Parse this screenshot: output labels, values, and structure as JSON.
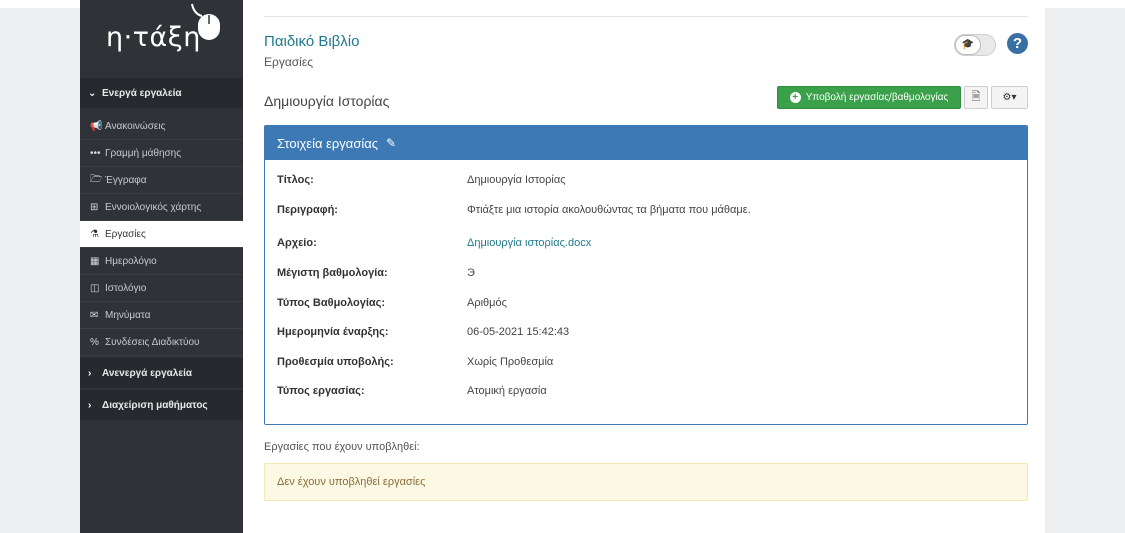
{
  "brand": {
    "logo_text": "η·τάξη"
  },
  "sidebar": {
    "sections": [
      {
        "label": "Ενεργά εργαλεία",
        "icon": "chevron-down-icon"
      },
      {
        "label": "Ανενεργά εργαλεία",
        "icon": "chevron-right-icon"
      },
      {
        "label": "Διαχείριση μαθήματος",
        "icon": "chevron-right-icon"
      }
    ],
    "items": [
      {
        "label": "Ανακοινώσεις",
        "icon": "megaphone-icon"
      },
      {
        "label": "Γραμμή μάθησης",
        "icon": "ellipsis-icon"
      },
      {
        "label": "Έγγραφα",
        "icon": "folder-icon"
      },
      {
        "label": "Εννοιολογικός χάρτης",
        "icon": "sitemap-icon"
      },
      {
        "label": "Εργασίες",
        "icon": "flask-icon",
        "active": true
      },
      {
        "label": "Ημερολόγιο",
        "icon": "calendar-icon"
      },
      {
        "label": "Ιστολόγιο",
        "icon": "columns-icon"
      },
      {
        "label": "Μηνύματα",
        "icon": "envelope-icon"
      },
      {
        "label": "Συνδέσεις Διαδικτύου",
        "icon": "link-icon"
      }
    ]
  },
  "header": {
    "course_title": "Παιδικό Βιβλίο",
    "course_subtitle": "Εργασίες",
    "help_glyph": "?"
  },
  "toolbar": {
    "section_title": "Δημιουργία Ιστορίας",
    "submit_label": "Υποβολή εργασίας/βαθμολογίας"
  },
  "panel": {
    "title": "Στοιχεία εργασίας",
    "rows": [
      {
        "label": "Τίτλος:",
        "value": "Δημιουργία Ιστορίας"
      },
      {
        "label": "Περιγραφή:",
        "value": "Φτιάξτε μια ιστορία ακολουθώντας τα βήματα που μάθαμε."
      },
      {
        "label": "Αρχείο:",
        "value": "Δημιουργία ιστορίας.docx"
      },
      {
        "label": "Μέγιστη βαθμολογία:",
        "value": "Э"
      },
      {
        "label": "Τύπος Βαθμολογίας:",
        "value": "Αριθμός"
      },
      {
        "label": "Ημερομηνία έναρξης:",
        "value": "06-05-2021 15:42:43"
      },
      {
        "label": "Προθεσμία υποβολής:",
        "value": "Χωρίς Προθεσμία"
      },
      {
        "label": "Τύπος εργασίας:",
        "value": "Ατομική εργασία"
      }
    ]
  },
  "submissions": {
    "label": "Εργασίες που έχουν υποβληθεί:",
    "empty_message": "Δεν έχουν υποβληθεί εργασίες"
  },
  "colors": {
    "sidebar_bg": "#2f3338",
    "panel_blue": "#3d7ab5",
    "accent_teal": "#1e7a8c",
    "success_green": "#3aa14a",
    "alert_bg": "#fcf8e3"
  }
}
